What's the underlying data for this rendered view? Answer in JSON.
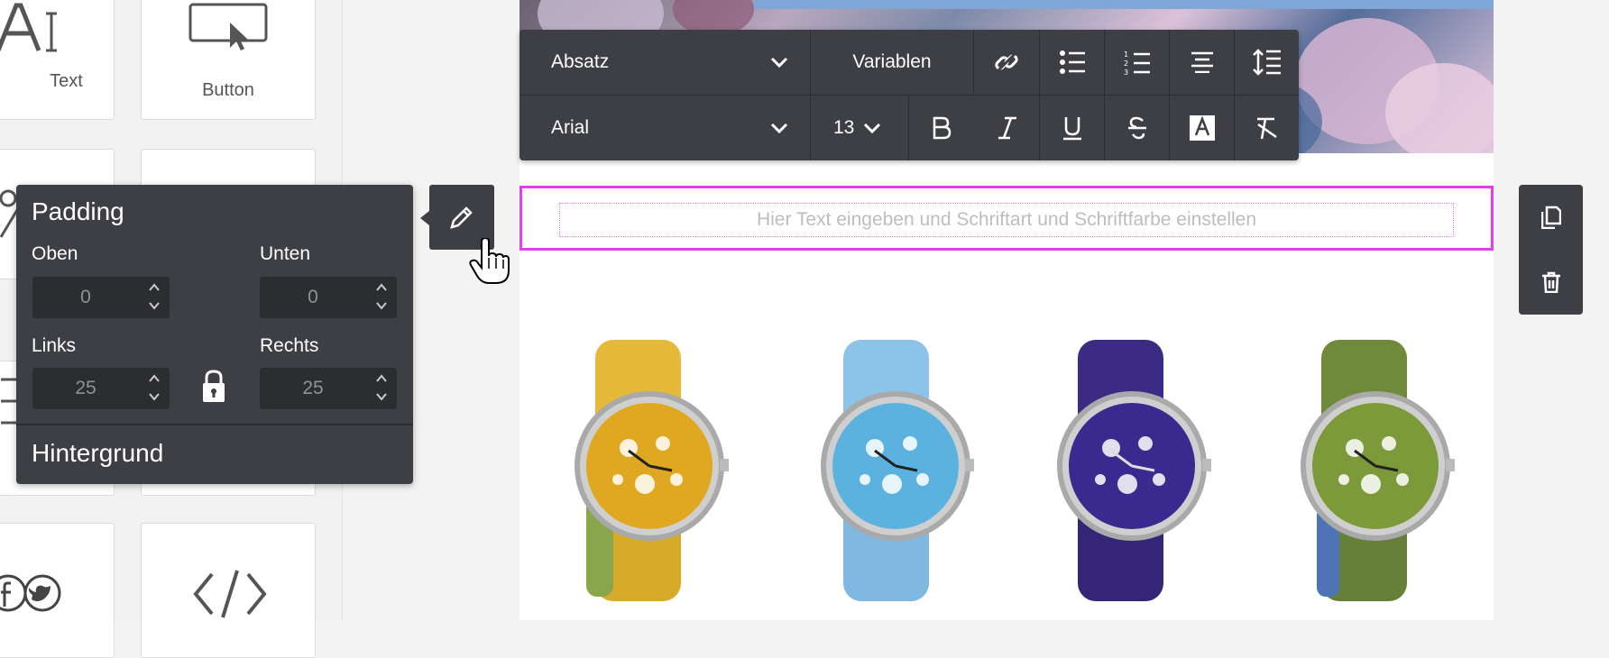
{
  "blocks": {
    "text_label": "Text",
    "button_label": "Button"
  },
  "toolbar": {
    "format_select": "Absatz",
    "variables_button": "Variablen",
    "font_select": "Arial",
    "font_size": "13"
  },
  "text_block": {
    "placeholder": "Hier Text eingeben und Schriftart und Schriftfarbe einstellen"
  },
  "padding_panel": {
    "title": "Padding",
    "top_label": "Oben",
    "top_value": "0",
    "bottom_label": "Unten",
    "bottom_value": "0",
    "left_label": "Links",
    "left_value": "25",
    "right_label": "Rechts",
    "right_value": "25",
    "background_section": "Hintergrund"
  },
  "colors": {
    "accent": "#e040e8",
    "toolbar_bg": "#3d3f45"
  }
}
